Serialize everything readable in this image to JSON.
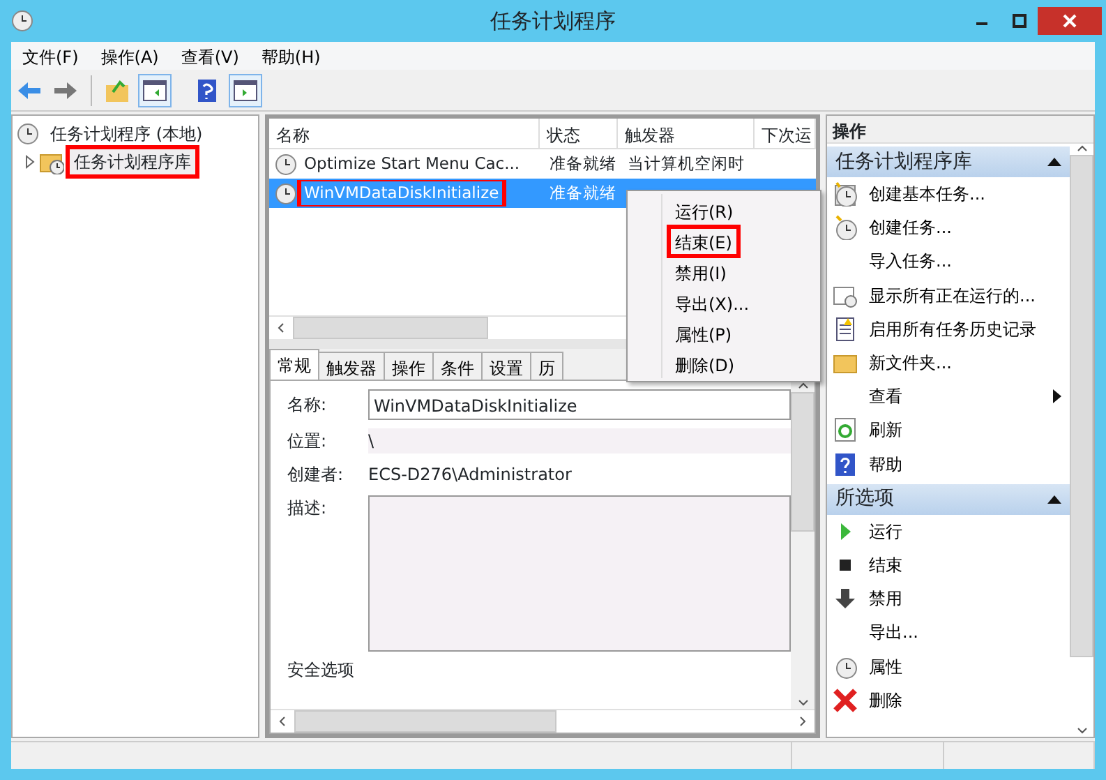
{
  "window": {
    "title": "任务计划程序"
  },
  "menu": [
    "文件(F)",
    "操作(A)",
    "查看(V)",
    "帮助(H)"
  ],
  "tree": [
    {
      "label": "任务计划程序 (本地)",
      "children": [
        {
          "label": "任务计划程序库",
          "expanded": false,
          "annotated": true
        }
      ]
    }
  ],
  "task_table": {
    "columns": [
      "名称",
      "状态",
      "触发器",
      "下次运"
    ],
    "rows": [
      {
        "cells": [
          "Optimize Start Menu Cac...",
          "准备就绪",
          "当计算机空闲时"
        ],
        "selected": false,
        "annotated": false
      },
      {
        "cells": [
          "WinVMDataDiskInitialize",
          "准备就绪"
        ],
        "selected": true,
        "annotated": true
      }
    ]
  },
  "context_menu": [
    {
      "label": "运行(R)",
      "annotated": false
    },
    {
      "label": "结束(E)",
      "annotated": true
    },
    {
      "label": "禁用(I)",
      "annotated": false
    },
    {
      "label": "导出(X)...",
      "annotated": false
    },
    {
      "label": "属性(P)",
      "annotated": false
    },
    {
      "label": "删除(D)",
      "annotated": false
    }
  ],
  "detail_tabs": [
    {
      "label": "常规",
      "selected": true
    },
    {
      "label": "触发器",
      "selected": false
    },
    {
      "label": "操作",
      "selected": false
    },
    {
      "label": "条件",
      "selected": false
    },
    {
      "label": "设置",
      "selected": false
    },
    {
      "label": "历",
      "selected": false
    }
  ],
  "general": {
    "name_label": "名称:",
    "name_value": "WinVMDataDiskInitialize",
    "location_label": "位置:",
    "location_value": "\\",
    "author_label": "创建者:",
    "author_value": "ECS-D276\\Administrator",
    "description_label": "描述:",
    "security_label": "安全选项"
  },
  "actions": {
    "title": "操作",
    "sections": [
      {
        "title": "任务计划程序库",
        "expanded": true,
        "items": [
          {
            "label": "创建基本任务...",
            "kind": "action"
          },
          {
            "label": "创建任务...",
            "kind": "action"
          },
          {
            "label": "导入任务...",
            "kind": "action"
          },
          {
            "label": "显示所有正在运行的...",
            "kind": "action"
          },
          {
            "label": "启用所有任务历史记录",
            "kind": "action"
          },
          {
            "label": "新文件夹...",
            "kind": "action"
          },
          {
            "label": "查看",
            "kind": "submenu"
          },
          {
            "label": "刷新",
            "kind": "action"
          },
          {
            "label": "帮助",
            "kind": "action"
          }
        ]
      },
      {
        "title": "所选项",
        "expanded": true,
        "items": [
          {
            "label": "运行",
            "kind": "action"
          },
          {
            "label": "结束",
            "kind": "action"
          },
          {
            "label": "禁用",
            "kind": "action"
          },
          {
            "label": "导出...",
            "kind": "action"
          },
          {
            "label": "属性",
            "kind": "action"
          },
          {
            "label": "删除",
            "kind": "action"
          }
        ]
      }
    ]
  }
}
